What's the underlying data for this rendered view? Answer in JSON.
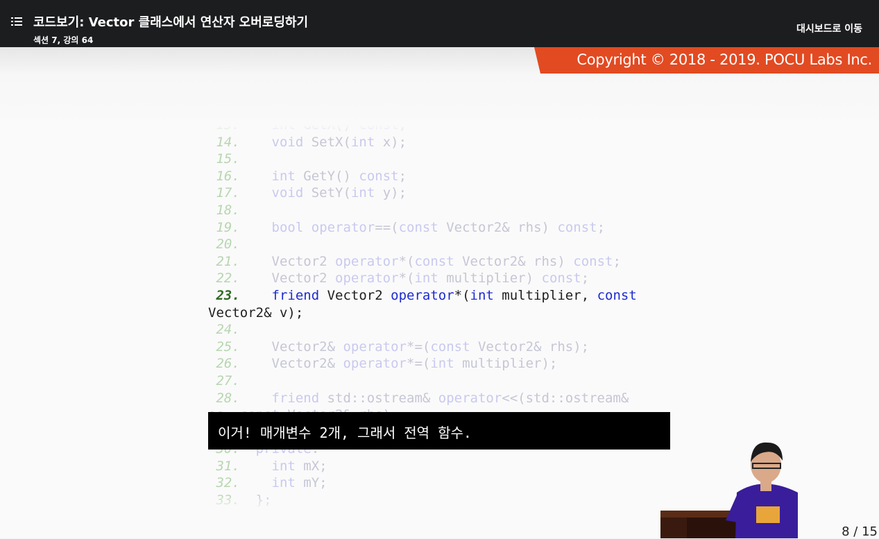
{
  "header": {
    "title": "코드보기: Vector 클래스에서 연산자 오버로딩하기",
    "subtitle": "섹션 7, 강의 64",
    "dashboard_link": "대시보드로 이동"
  },
  "copyright": "Copyright © 2018 - 2019. POCU Labs Inc.",
  "code_lines": [
    {
      "n": "13.",
      "t": "    int GetX() const;"
    },
    {
      "n": "14.",
      "t": "    void SetX(int x);"
    },
    {
      "n": "15.",
      "t": ""
    },
    {
      "n": "16.",
      "t": "    int GetY() const;"
    },
    {
      "n": "17.",
      "t": "    void SetY(int y);"
    },
    {
      "n": "18.",
      "t": ""
    },
    {
      "n": "19.",
      "t": "    bool operator==(const Vector2& rhs) const;"
    },
    {
      "n": "20.",
      "t": ""
    },
    {
      "n": "21.",
      "t": "    Vector2 operator*(const Vector2& rhs) const;"
    },
    {
      "n": "22.",
      "t": "    Vector2 operator*(int multiplier) const;"
    },
    {
      "n": "23.",
      "t": "    friend Vector2 operator*(int multiplier, const",
      "active": true
    },
    {
      "n": "",
      "t": "Vector2& v);",
      "active": true
    },
    {
      "n": "24.",
      "t": ""
    },
    {
      "n": "25.",
      "t": "    Vector2& operator*=(const Vector2& rhs);"
    },
    {
      "n": "26.",
      "t": "    Vector2& operator*=(int multiplier);"
    },
    {
      "n": "27.",
      "t": ""
    },
    {
      "n": "28.",
      "t": "    friend std::ostream& operator<<(std::ostream&"
    },
    {
      "n": "",
      "t": "os, const Vector2& rhs);"
    },
    {
      "n": "29.",
      "t": ""
    },
    {
      "n": "30.",
      "t": "  private:"
    },
    {
      "n": "31.",
      "t": "    int mX;"
    },
    {
      "n": "32.",
      "t": "    int mY;"
    },
    {
      "n": "33.",
      "t": "  };"
    }
  ],
  "subtitle_text": "이거! 매개변수 2개, 그래서 전역 함수.",
  "slide_counter": "8 / 15",
  "colors": {
    "topbar": "#1c1d1f",
    "copyright_bg": "#e24a22",
    "keyword_active": "#1e2bcf",
    "linenum_active": "#2f6b23"
  }
}
